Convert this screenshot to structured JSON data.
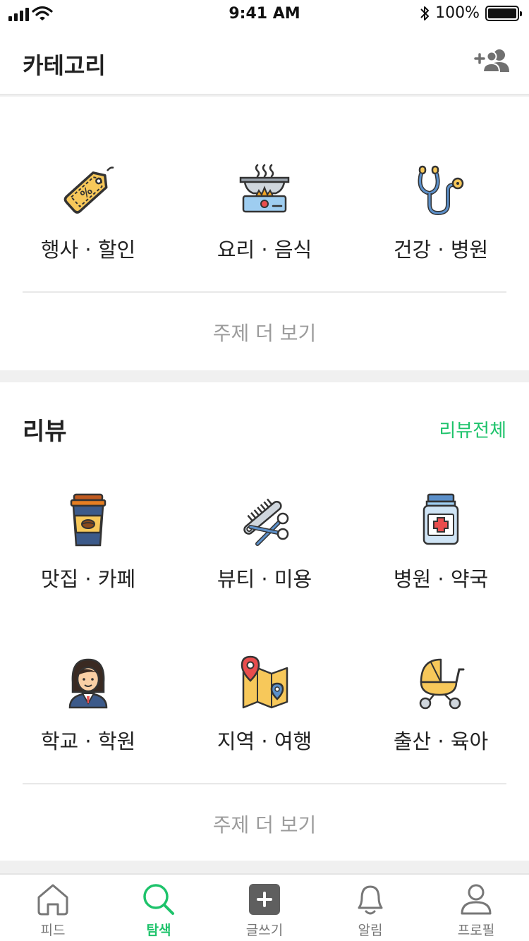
{
  "status_bar": {
    "time": "9:41 AM",
    "battery": "100%",
    "battery_level": 1.0
  },
  "header": {
    "title": "카테고리",
    "action_icon": "add-friend-icon"
  },
  "category": {
    "items": [
      {
        "label": "행사 · 할인",
        "icon": "discount-tag-icon"
      },
      {
        "label": "요리 · 음식",
        "icon": "cooking-pot-icon"
      },
      {
        "label": "건강 · 병원",
        "icon": "stethoscope-icon"
      }
    ],
    "more_label": "주제 더 보기"
  },
  "review": {
    "title": "리뷰",
    "link": "리뷰전체",
    "items": [
      {
        "label": "맛집 · 카페",
        "icon": "coffee-cup-icon"
      },
      {
        "label": "뷰티 · 미용",
        "icon": "comb-scissors-icon"
      },
      {
        "label": "병원 · 약국",
        "icon": "medicine-bottle-icon"
      },
      {
        "label": "학교 · 학원",
        "icon": "student-icon"
      },
      {
        "label": "지역 · 여행",
        "icon": "map-pin-icon"
      },
      {
        "label": "출산 · 육아",
        "icon": "stroller-icon"
      }
    ],
    "more_label": "주제 더 보기"
  },
  "tabbar": {
    "tabs": [
      {
        "label": "피드",
        "icon": "home-icon",
        "active": false
      },
      {
        "label": "탐색",
        "icon": "search-icon",
        "active": true
      },
      {
        "label": "글쓰기",
        "icon": "write-plus-icon",
        "active": false
      },
      {
        "label": "알림",
        "icon": "bell-icon",
        "active": false
      },
      {
        "label": "프로필",
        "icon": "profile-icon",
        "active": false
      }
    ]
  },
  "colors": {
    "accent": "#1ec36b",
    "muted": "#9b9b9b",
    "text": "#222222",
    "divider": "#e8e8e8"
  }
}
